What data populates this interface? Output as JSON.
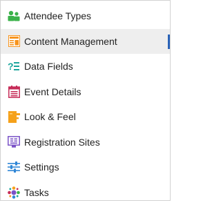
{
  "menu": {
    "items": [
      {
        "label": "Attendee Types",
        "icon": "people-icon",
        "active": false
      },
      {
        "label": "Content Management",
        "icon": "content-management-icon",
        "active": true
      },
      {
        "label": "Data Fields",
        "icon": "data-fields-icon",
        "active": false
      },
      {
        "label": "Event Details",
        "icon": "event-details-icon",
        "active": false
      },
      {
        "label": "Look & Feel",
        "icon": "look-and-feel-icon",
        "active": false
      },
      {
        "label": "Registration Sites",
        "icon": "registration-sites-icon",
        "active": false
      },
      {
        "label": "Settings",
        "icon": "settings-sliders-icon",
        "active": false
      },
      {
        "label": "Tasks",
        "icon": "tasks-icon",
        "active": false
      }
    ]
  },
  "colors": {
    "active_background": "#eeeeee",
    "active_indicator": "#2a63b8",
    "people_green": "#3bb24a",
    "content_orange": "#f7941d",
    "data_fields_teal": "#1aa59c",
    "event_red": "#c62c58",
    "look_feel_orange": "#f5a11a",
    "registration_purple": "#7a52c7",
    "settings_blue": "#2f86d6"
  }
}
